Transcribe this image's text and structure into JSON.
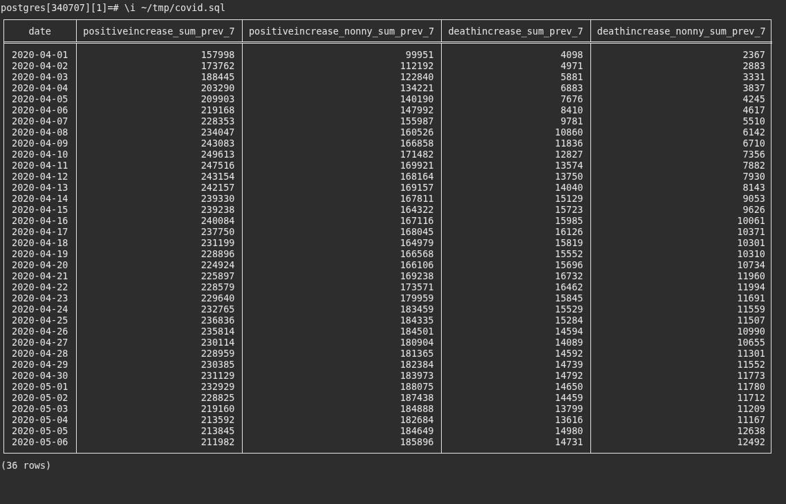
{
  "terminal": {
    "command_line": "postgres[340707][1]=# \\i ~/tmp/covid.sql"
  },
  "table": {
    "columns": [
      "date",
      "positiveincrease_sum_prev_7",
      "positiveincrease_nonny_sum_prev_7",
      "deathincrease_sum_prev_7",
      "deathincrease_nonny_sum_prev_7"
    ],
    "rows": [
      [
        "2020-04-01",
        "157998",
        "99951",
        "4098",
        "2367"
      ],
      [
        "2020-04-02",
        "173762",
        "112192",
        "4971",
        "2883"
      ],
      [
        "2020-04-03",
        "188445",
        "122840",
        "5881",
        "3331"
      ],
      [
        "2020-04-04",
        "203290",
        "134221",
        "6883",
        "3837"
      ],
      [
        "2020-04-05",
        "209903",
        "140190",
        "7676",
        "4245"
      ],
      [
        "2020-04-06",
        "219168",
        "147992",
        "8410",
        "4617"
      ],
      [
        "2020-04-07",
        "228353",
        "155987",
        "9781",
        "5510"
      ],
      [
        "2020-04-08",
        "234047",
        "160526",
        "10860",
        "6142"
      ],
      [
        "2020-04-09",
        "243083",
        "166858",
        "11836",
        "6710"
      ],
      [
        "2020-04-10",
        "249613",
        "171482",
        "12827",
        "7356"
      ],
      [
        "2020-04-11",
        "247516",
        "169921",
        "13574",
        "7882"
      ],
      [
        "2020-04-12",
        "243154",
        "168164",
        "13750",
        "7930"
      ],
      [
        "2020-04-13",
        "242157",
        "169157",
        "14040",
        "8143"
      ],
      [
        "2020-04-14",
        "239330",
        "167811",
        "15129",
        "9053"
      ],
      [
        "2020-04-15",
        "239238",
        "164322",
        "15723",
        "9626"
      ],
      [
        "2020-04-16",
        "240084",
        "167116",
        "15985",
        "10061"
      ],
      [
        "2020-04-17",
        "237750",
        "168045",
        "16126",
        "10371"
      ],
      [
        "2020-04-18",
        "231199",
        "164979",
        "15819",
        "10301"
      ],
      [
        "2020-04-19",
        "228896",
        "166568",
        "15552",
        "10310"
      ],
      [
        "2020-04-20",
        "224924",
        "166106",
        "15696",
        "10734"
      ],
      [
        "2020-04-21",
        "225897",
        "169238",
        "16732",
        "11960"
      ],
      [
        "2020-04-22",
        "228579",
        "173571",
        "16462",
        "11994"
      ],
      [
        "2020-04-23",
        "229640",
        "179959",
        "15845",
        "11691"
      ],
      [
        "2020-04-24",
        "232765",
        "183459",
        "15529",
        "11559"
      ],
      [
        "2020-04-25",
        "236836",
        "184335",
        "15284",
        "11507"
      ],
      [
        "2020-04-26",
        "235814",
        "184501",
        "14594",
        "10990"
      ],
      [
        "2020-04-27",
        "230114",
        "180904",
        "14089",
        "10655"
      ],
      [
        "2020-04-28",
        "228959",
        "181365",
        "14592",
        "11301"
      ],
      [
        "2020-04-29",
        "230385",
        "182384",
        "14739",
        "11552"
      ],
      [
        "2020-04-30",
        "231129",
        "183973",
        "14792",
        "11773"
      ],
      [
        "2020-05-01",
        "232929",
        "188075",
        "14650",
        "11780"
      ],
      [
        "2020-05-02",
        "228825",
        "187438",
        "14459",
        "11712"
      ],
      [
        "2020-05-03",
        "219160",
        "184888",
        "13799",
        "11209"
      ],
      [
        "2020-05-04",
        "213592",
        "182684",
        "13616",
        "11167"
      ],
      [
        "2020-05-05",
        "213845",
        "184649",
        "14980",
        "12638"
      ],
      [
        "2020-05-06",
        "211982",
        "185896",
        "14731",
        "12492"
      ]
    ]
  },
  "row_count": "(36 rows)"
}
